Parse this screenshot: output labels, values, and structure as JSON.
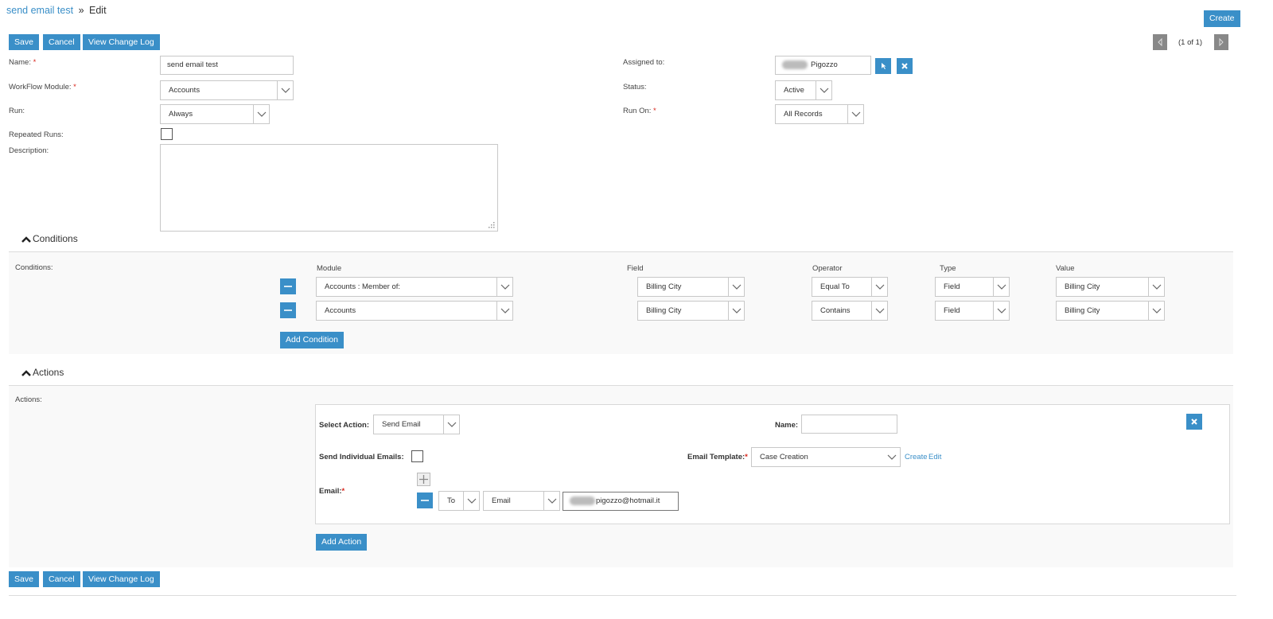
{
  "breadcrumb": {
    "record": "send email test",
    "separator": "»",
    "page": "Edit"
  },
  "header": {
    "create_label": "Create"
  },
  "toolbar": {
    "save_label": "Save",
    "cancel_label": "Cancel",
    "change_log_label": "View Change Log"
  },
  "pagination": {
    "text": "(1 of 1)"
  },
  "form": {
    "name": {
      "label": "Name:",
      "required": "*",
      "value": "send email test"
    },
    "workflow_module": {
      "label": "WorkFlow Module:",
      "required": "*",
      "value": "Accounts"
    },
    "run": {
      "label": "Run:",
      "value": "Always"
    },
    "repeated_runs": {
      "label": "Repeated Runs:",
      "checked": false
    },
    "description": {
      "label": "Description:",
      "value": ""
    },
    "assigned_to": {
      "label": "Assigned to:",
      "value": "Pigozzo"
    },
    "status": {
      "label": "Status:",
      "value": "Active"
    },
    "run_on": {
      "label": "Run On:",
      "required": "*",
      "value": "All Records"
    }
  },
  "conditions": {
    "section_title": "Conditions",
    "label": "Conditions:",
    "headers": {
      "module": "Module",
      "field": "Field",
      "operator": "Operator",
      "type": "Type",
      "value": "Value"
    },
    "rows": [
      {
        "module": "Accounts : Member of:",
        "field": "Billing City",
        "operator": "Equal To",
        "type": "Field",
        "value": "Billing City"
      },
      {
        "module": "Accounts",
        "field": "Billing City",
        "operator": "Contains",
        "type": "Field",
        "value": "Billing City"
      }
    ],
    "add_label": "Add Condition"
  },
  "actions": {
    "section_title": "Actions",
    "label": "Actions:",
    "select_action_label": "Select Action:",
    "select_action_value": "Send Email",
    "name_label": "Name:",
    "name_value": "",
    "send_individual_label": "Send Individual Emails:",
    "email_template_label": "Email Template:",
    "email_template_required": "*",
    "email_template_value": "Case Creation",
    "create_link": "Create",
    "edit_link": "Edit",
    "email_label": "Email:",
    "email_required": "*",
    "email_rows": [
      {
        "recipient_type": "To",
        "source": "Email",
        "address": "pigozzo@hotmail.it"
      }
    ],
    "add_label": "Add Action"
  },
  "icons": [
    "chevron-up-icon",
    "chevron-down-icon",
    "minus-icon",
    "plus-icon",
    "close-icon",
    "cursor-select-icon",
    "prev-page-icon",
    "next-page-icon",
    "resize-grip-icon"
  ],
  "colors": {
    "accent": "#3a8fc8",
    "required": "#d9261c",
    "page_bg": "#ffffff",
    "panel_bg": "#f9f9f9"
  }
}
